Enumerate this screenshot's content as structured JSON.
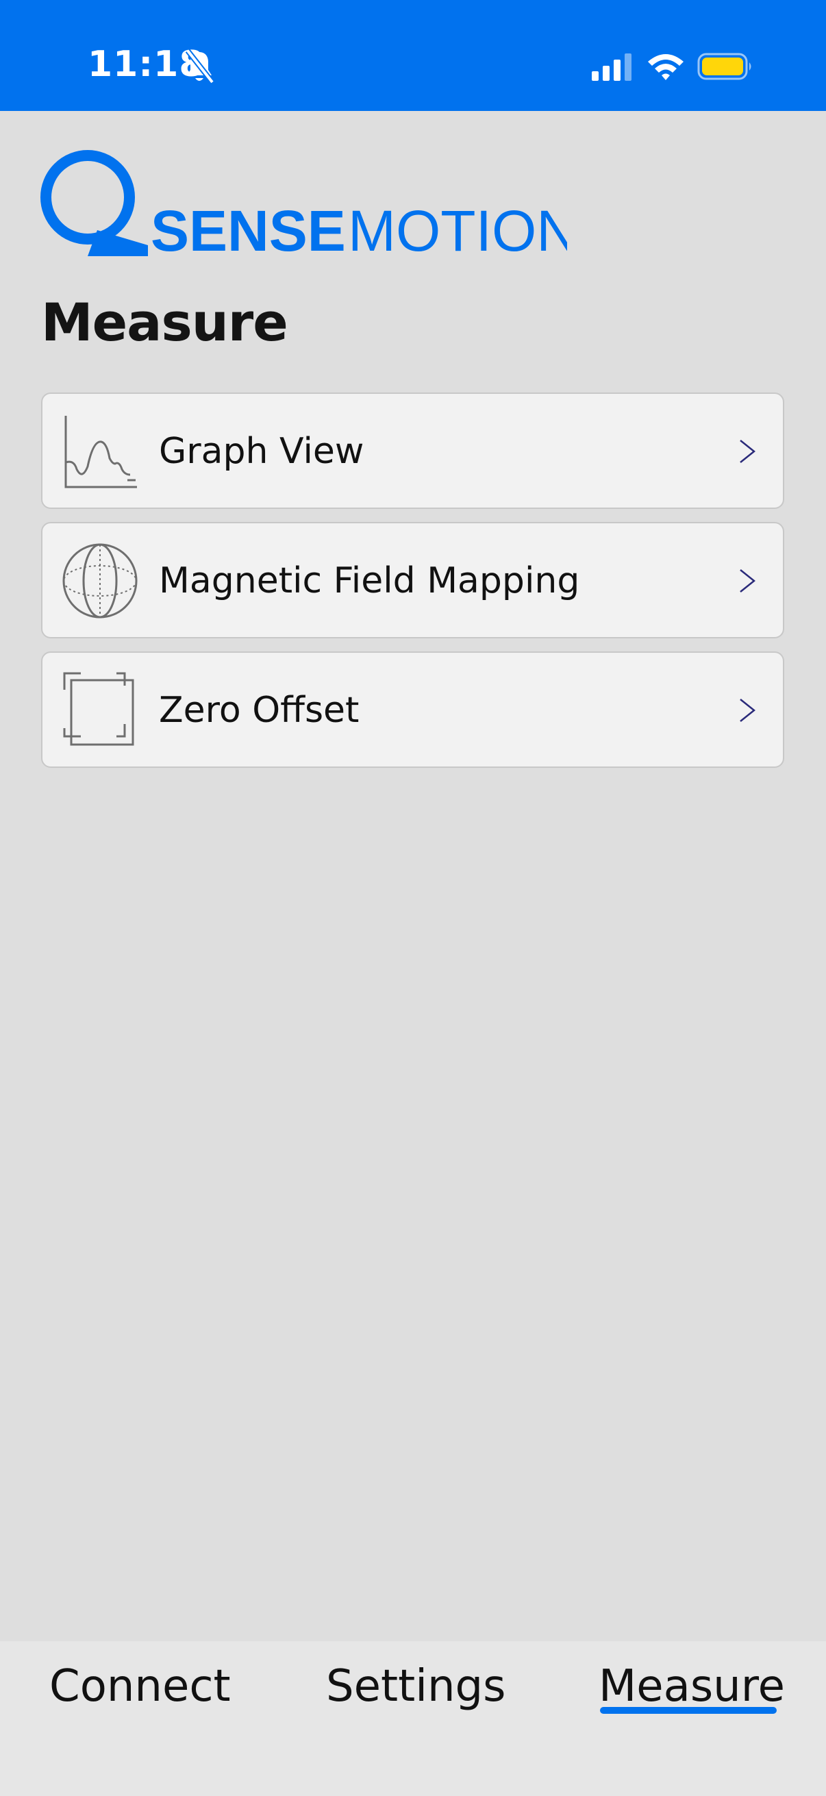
{
  "status_bar": {
    "time": "11:18",
    "background": "#0172ee",
    "icons": [
      "bell-slash-icon",
      "cellular-signal-icon",
      "wifi-icon",
      "battery-icon"
    ],
    "battery_color": "#ffd60a"
  },
  "logo": {
    "part1": "SENSE",
    "part2": "MOTION",
    "color": "#0172ee"
  },
  "page_title": "Measure",
  "menu": {
    "items": [
      {
        "label": "Graph View",
        "icon": "line-graph-icon"
      },
      {
        "label": "Magnetic Field Mapping",
        "icon": "globe-icon"
      },
      {
        "label": "Zero Offset",
        "icon": "zero-offset-frame-icon"
      }
    ],
    "chevron_icon": "chevron-right-icon",
    "chevron_color": "#2a2a7a"
  },
  "tab_bar": {
    "tabs": [
      {
        "label": "Connect",
        "selected": false
      },
      {
        "label": "Settings",
        "selected": false
      },
      {
        "label": "Measure",
        "selected": true
      }
    ],
    "accent": "#0172ee"
  }
}
